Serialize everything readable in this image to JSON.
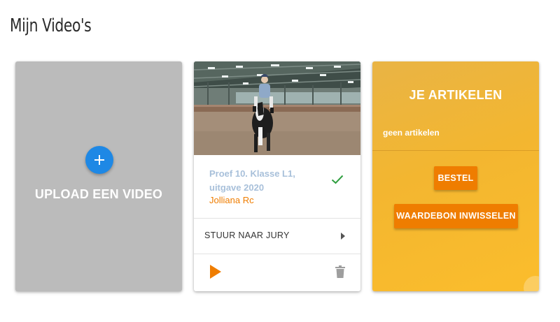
{
  "page": {
    "title": "Mijn Video's"
  },
  "upload_card": {
    "label": "UPLOAD EEN VIDEO",
    "button_icon": "plus-icon",
    "background": "#bbbbbb",
    "button_color": "#1e88e5"
  },
  "video_card": {
    "thumbnail": "rider-on-horse-in-indoor-arena",
    "title": "Proef 10. Klasse L1, uitgave 2020",
    "rider": "Jolliana Rc",
    "status_icon": "check-icon",
    "jury_action": "STUUR NAAR JURY",
    "jury_icon": "chevron-right-icon",
    "play_icon": "play-icon",
    "delete_icon": "trash-icon",
    "accent": "#ef7d00",
    "title_color": "#a8c0da",
    "check_color": "#2e9e3e"
  },
  "articles_card": {
    "title": "JE ARTIKELEN",
    "empty_text": "geen artikelen",
    "order_button": "BESTEL",
    "voucher_button": "WAARDEBON INWISSELEN",
    "background": "#f3b630"
  }
}
